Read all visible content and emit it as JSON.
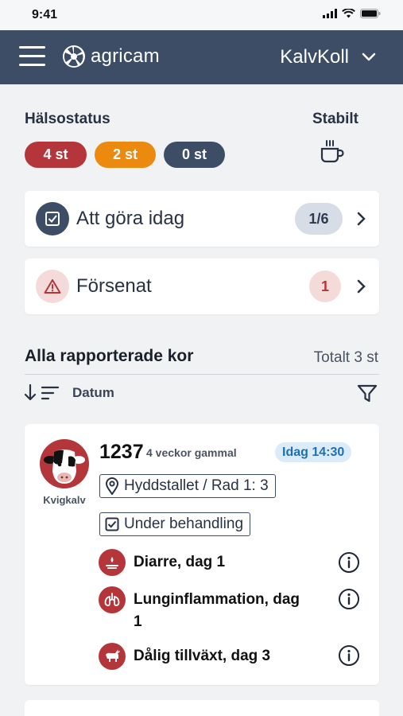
{
  "status_bar": {
    "time": "9:41"
  },
  "header": {
    "logo_text": "agricam",
    "app_name": "KalvKoll"
  },
  "health": {
    "title": "Hälsostatus",
    "counts": [
      "4 st",
      "2 st",
      "0 st"
    ],
    "stable_label": "Stabilt"
  },
  "todo": {
    "label": "Att göra idag",
    "progress": "1/6"
  },
  "late": {
    "label": "Försenat",
    "count": "1"
  },
  "list": {
    "title": "Alla rapporterade kor",
    "total": "Totalt 3 st",
    "sort_label": "Datum"
  },
  "cow": {
    "id": "1237",
    "age": "4 veckor gammal",
    "time": "Idag 14:30",
    "type": "Kvigkalv",
    "location": "Hyddstallet / Rad 1: 3",
    "status": "Under behandling",
    "diagnoses": [
      {
        "text": "Diarre, dag 1",
        "icon": "diarrhea-icon"
      },
      {
        "text": "Lunginflammation, dag 1",
        "icon": "lungs-icon"
      },
      {
        "text": "Dålig tillväxt, dag 3",
        "icon": "growth-icon"
      }
    ]
  },
  "colors": {
    "header": "#3d4d66",
    "red": "#b5363a",
    "orange": "#ec8a10",
    "dark": "#3d4d66",
    "blue_badge": "#dcebf8"
  }
}
